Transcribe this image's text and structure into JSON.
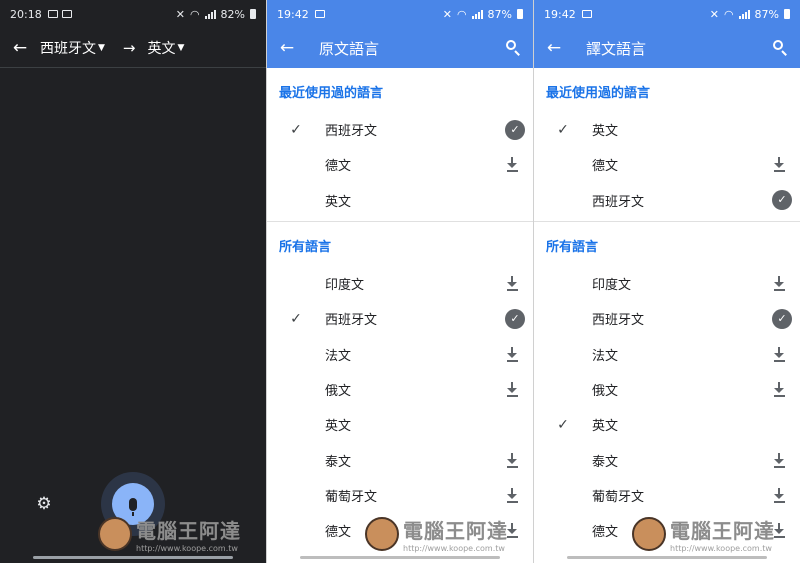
{
  "screen1": {
    "status_time": "20:18",
    "status_battery": "82%",
    "source_lang": "西班牙文",
    "target_lang": "英文"
  },
  "screen2": {
    "status_time": "19:42",
    "status_battery": "87%",
    "title": "原文語言",
    "recent_title": "最近使用過的語言",
    "recent": [
      {
        "name": "西班牙文",
        "checked": true,
        "state": "downloaded"
      },
      {
        "name": "德文",
        "checked": false,
        "state": "download"
      },
      {
        "name": "英文",
        "checked": false,
        "state": "none"
      }
    ],
    "all_title": "所有語言",
    "all": [
      {
        "name": "印度文",
        "checked": false,
        "state": "download"
      },
      {
        "name": "西班牙文",
        "checked": true,
        "state": "downloaded"
      },
      {
        "name": "法文",
        "checked": false,
        "state": "download"
      },
      {
        "name": "俄文",
        "checked": false,
        "state": "download"
      },
      {
        "name": "英文",
        "checked": false,
        "state": "none"
      },
      {
        "name": "泰文",
        "checked": false,
        "state": "download"
      },
      {
        "name": "葡萄牙文",
        "checked": false,
        "state": "download"
      },
      {
        "name": "德文",
        "checked": false,
        "state": "download"
      }
    ]
  },
  "screen3": {
    "status_time": "19:42",
    "status_battery": "87%",
    "title": "譯文語言",
    "recent_title": "最近使用過的語言",
    "recent": [
      {
        "name": "英文",
        "checked": true,
        "state": "none"
      },
      {
        "name": "德文",
        "checked": false,
        "state": "download"
      },
      {
        "name": "西班牙文",
        "checked": false,
        "state": "downloaded"
      }
    ],
    "all_title": "所有語言",
    "all": [
      {
        "name": "印度文",
        "checked": false,
        "state": "download"
      },
      {
        "name": "西班牙文",
        "checked": false,
        "state": "downloaded"
      },
      {
        "name": "法文",
        "checked": false,
        "state": "download"
      },
      {
        "name": "俄文",
        "checked": false,
        "state": "download"
      },
      {
        "name": "英文",
        "checked": true,
        "state": "none"
      },
      {
        "name": "泰文",
        "checked": false,
        "state": "download"
      },
      {
        "name": "葡萄牙文",
        "checked": false,
        "state": "download"
      },
      {
        "name": "德文",
        "checked": false,
        "state": "download"
      }
    ]
  },
  "icons": {
    "check": "✓",
    "downloaded": "✓"
  },
  "watermark": {
    "title": "電腦王阿達",
    "url": "http://www.koope.com.tw"
  },
  "colors": {
    "app_bar": "#4a86e8",
    "accent": "#1a73e8",
    "dark_bg": "#202124",
    "mic": "#8ab4f8"
  }
}
